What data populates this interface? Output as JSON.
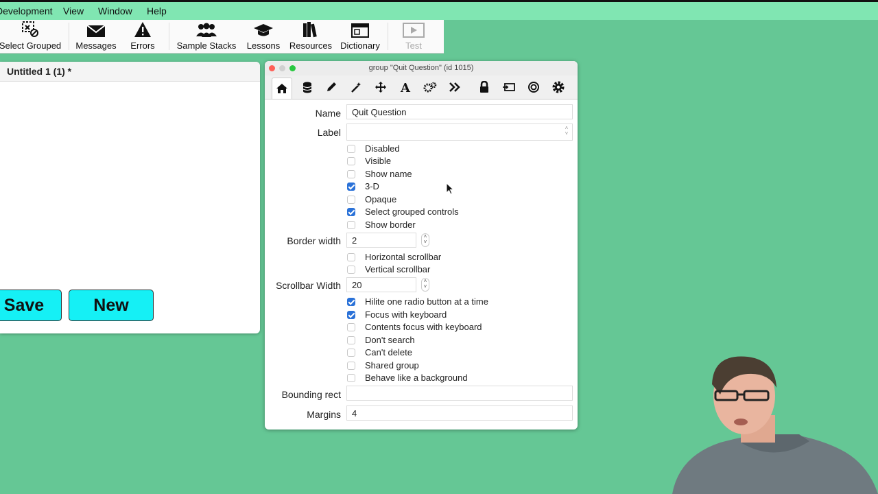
{
  "menubar": {
    "items": [
      "Development",
      "View",
      "Window",
      "Help"
    ]
  },
  "toolbar": {
    "items": [
      {
        "label": "Select Grouped",
        "icon": "select-grouped-icon"
      },
      {
        "label": "Messages",
        "icon": "envelope-icon"
      },
      {
        "label": "Errors",
        "icon": "warning-icon"
      },
      {
        "label": "Sample Stacks",
        "icon": "people-icon"
      },
      {
        "label": "Lessons",
        "icon": "graduation-cap-icon"
      },
      {
        "label": "Resources",
        "icon": "books-icon"
      },
      {
        "label": "Dictionary",
        "icon": "dictionary-icon"
      },
      {
        "label": "Test",
        "icon": "play-icon"
      }
    ]
  },
  "stack": {
    "title": "Untitled 1 (1) *",
    "save_label": "Save",
    "new_label": "New",
    "button_color": "#15f0f5"
  },
  "inspector": {
    "title": "group \"Quit Question\" (id 1015)",
    "tabs": [
      "home-icon",
      "database-icon",
      "pencil-icon",
      "magic-wand-icon",
      "move-icon",
      "text-icon",
      "gears-icon",
      "chevrons-icon",
      "lock-icon",
      "script-icon",
      "target-icon",
      "gear-icon"
    ],
    "name_label": "Name",
    "name_value": "Quit Question",
    "label_label": "Label",
    "label_value": "",
    "checks1": [
      {
        "label": "Disabled",
        "checked": false
      },
      {
        "label": "Visible",
        "checked": false
      },
      {
        "label": "Show name",
        "checked": false
      },
      {
        "label": "3-D",
        "checked": true
      },
      {
        "label": "Opaque",
        "checked": false
      },
      {
        "label": "Select grouped controls",
        "checked": true
      },
      {
        "label": "Show border",
        "checked": false
      }
    ],
    "border_width_label": "Border width",
    "border_width_value": "2",
    "checks2": [
      {
        "label": "Horizontal scrollbar",
        "checked": false
      },
      {
        "label": "Vertical scrollbar",
        "checked": false
      }
    ],
    "scrollbar_width_label": "Scrollbar Width",
    "scrollbar_width_value": "20",
    "checks3": [
      {
        "label": "Hilite one radio button at a time",
        "checked": true
      },
      {
        "label": "Focus with keyboard",
        "checked": true
      },
      {
        "label": "Contents focus with keyboard",
        "checked": false
      },
      {
        "label": "Don't search",
        "checked": false
      },
      {
        "label": "Can't delete",
        "checked": false
      },
      {
        "label": "Shared group",
        "checked": false
      },
      {
        "label": "Behave like a background",
        "checked": false
      }
    ],
    "bounding_rect_label": "Bounding rect",
    "bounding_rect_value": "",
    "margins_label": "Margins",
    "margins_value": "4"
  },
  "colors": {
    "desktop": "#65c795",
    "menubar": "#80e6b2",
    "check_on": "#2b72d8"
  }
}
